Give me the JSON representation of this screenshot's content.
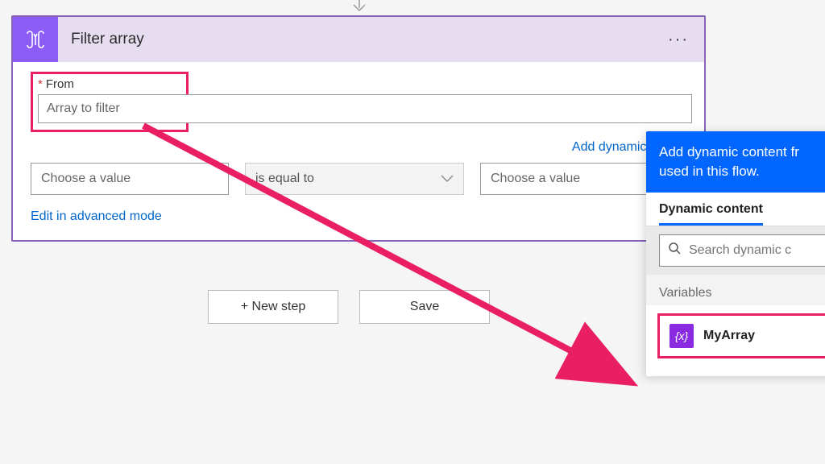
{
  "card": {
    "title": "Filter array",
    "icon_name": "data-operations-icon",
    "menu_icon": "ellipsis-icon"
  },
  "from": {
    "label": "From",
    "required_mark": "*",
    "placeholder": "Array to filter"
  },
  "dynamic_link": "Add dynamic conte",
  "filter": {
    "left_placeholder": "Choose a value",
    "operator": "is equal to",
    "right_placeholder": "Choose a value"
  },
  "advanced_link": "Edit in advanced mode",
  "buttons": {
    "new_step": "+ New step",
    "save": "Save"
  },
  "flyout": {
    "header": "Add dynamic content from the apps and connectors used in this flow.",
    "header_visible": "Add dynamic content fr",
    "header_line2": "used in this flow.",
    "tab_dynamic": "Dynamic content",
    "search_placeholder": "Search dynamic c",
    "section": "Variables",
    "item_label": "MyArray"
  },
  "colors": {
    "accent_purple": "#8B5CF6",
    "accent_blue": "#0066ff",
    "highlight_pink": "#E91E63",
    "var_purple": "#8A2BE2"
  }
}
